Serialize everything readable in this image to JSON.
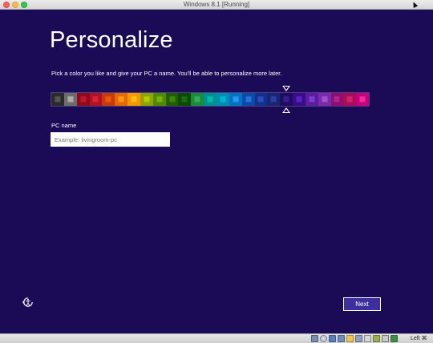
{
  "window": {
    "title": "Windows 8.1 [Running]"
  },
  "oobe": {
    "heading": "Personalize",
    "subtitle": "Pick a color you like and give your PC a name. You'll be able to personalize more later.",
    "palette": {
      "selected_index": 18,
      "swatches": [
        {
          "bg": "#2b2b2b",
          "accent": "#595959"
        },
        {
          "bg": "#6d6d6d",
          "accent": "#b3b3b3"
        },
        {
          "bg": "#8f0b1c",
          "accent": "#c1172b"
        },
        {
          "bg": "#b01222",
          "accent": "#e02638"
        },
        {
          "bg": "#c63b08",
          "accent": "#ef5a14"
        },
        {
          "bg": "#e56a00",
          "accent": "#ff9a1f"
        },
        {
          "bg": "#f29b00",
          "accent": "#ffc21c"
        },
        {
          "bg": "#8aa400",
          "accent": "#b4d200"
        },
        {
          "bg": "#4f8a00",
          "accent": "#79b800"
        },
        {
          "bg": "#235c00",
          "accent": "#3e8e00"
        },
        {
          "bg": "#0c4a08",
          "accent": "#1e7114"
        },
        {
          "bg": "#1b8a3c",
          "accent": "#2fb55d"
        },
        {
          "bg": "#00928c",
          "accent": "#00bfb4"
        },
        {
          "bg": "#008fb1",
          "accent": "#00b7e0"
        },
        {
          "bg": "#0072c6",
          "accent": "#2a9cf0"
        },
        {
          "bg": "#0a4ba8",
          "accent": "#2f74d8"
        },
        {
          "bg": "#12318a",
          "accent": "#2b52c0"
        },
        {
          "bg": "#1a2470",
          "accent": "#3140a8"
        },
        {
          "bg": "#200d5e",
          "accent": "#3a1f9a"
        },
        {
          "bg": "#3b0c8a",
          "accent": "#5b26c4"
        },
        {
          "bg": "#5b1c9e",
          "accent": "#8040d0"
        },
        {
          "bg": "#7b2aa8",
          "accent": "#a654d6"
        },
        {
          "bg": "#8c0f6e",
          "accent": "#b8238f"
        },
        {
          "bg": "#a80e56",
          "accent": "#d52279"
        },
        {
          "bg": "#c4007a",
          "accent": "#ff2aa6"
        }
      ]
    },
    "pc_name_label": "PC name",
    "pc_name_value": "",
    "pc_name_placeholder": "Example: livingroom-pc",
    "next_label": "Next"
  },
  "statusbar": {
    "host_key": "Left ⌘"
  }
}
